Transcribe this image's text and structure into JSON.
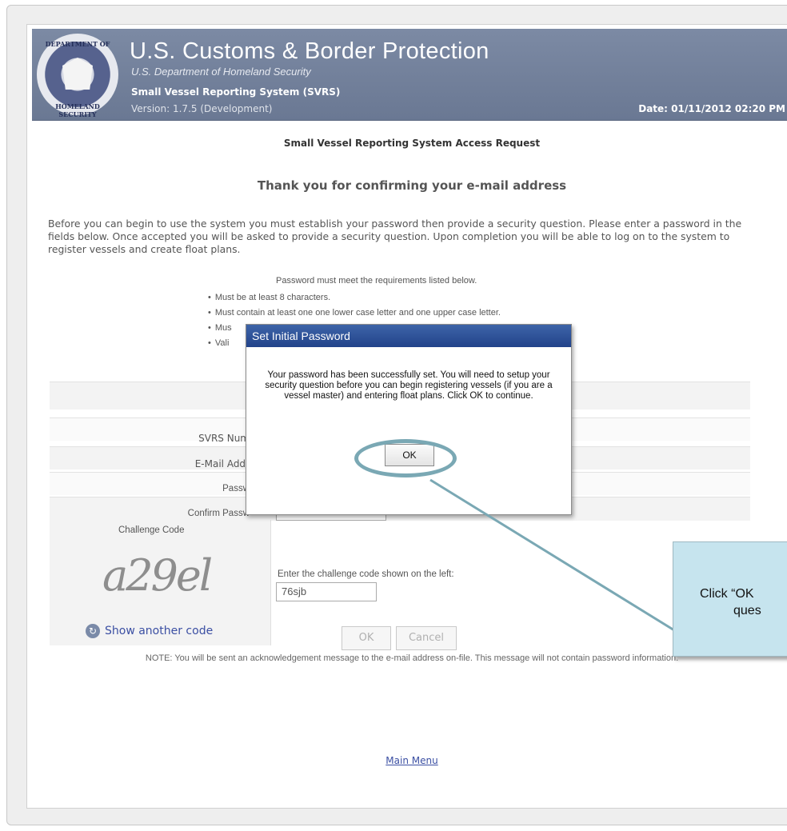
{
  "header": {
    "seal_top": "DEPARTMENT OF",
    "seal_bottom": "HOMELAND SECURITY",
    "agency_title": "U.S. Customs & Border Protection",
    "agency_subtitle": "U.S. Department of Homeland Security",
    "system_name": "Small Vessel Reporting System (SVRS)",
    "version": "Version: 1.7.5 (Development)",
    "date": "Date: 01/11/2012 02:20 PM"
  },
  "page": {
    "heading": "Small Vessel Reporting System Access Request",
    "confirm_heading": "Thank you for confirming your e-mail address",
    "intro": "Before you can begin to use the system you must establish your password then provide a security question. Please enter a password in the fields below. Once accepted you will be asked to provide a security question. Upon completion you will be able to log on to the system to register vessels and create float plans.",
    "requirements_title": "Password must meet the requirements listed below.",
    "requirements": [
      "Must be at least 8 characters.",
      "Must contain at least one one lower case letter and one upper case letter.",
      "Mus",
      "Vali"
    ]
  },
  "form": {
    "svrs_number_label": "SVRS Num",
    "email_label": "E-Mail Addr",
    "password_label": "Passw",
    "confirm_password_label": "Confirm Passw",
    "challenge_code_label": "Challenge Code",
    "captcha_text": "a29el",
    "show_another_code": "Show another code",
    "challenge_prompt": "Enter the challenge code shown on the left:",
    "challenge_value": "76sjb",
    "ok_button": "OK",
    "cancel_button": "Cancel"
  },
  "footer": {
    "note": "NOTE: You will be sent an acknowledgement message to the e-mail address on-file. This message will not contain password information.",
    "main_menu": "Main Menu"
  },
  "dialog": {
    "title": "Set Initial Password",
    "message": "Your password has been successfully set. You will need to setup your security question before you can begin registering vessels (if you are a vessel master) and entering float plans. Click OK to continue.",
    "ok_button": "OK"
  },
  "callout": {
    "line1": "Click “OK",
    "line2": "ques"
  },
  "colors": {
    "header_bg": "#6f7d97",
    "dialog_titlebar": "#2e4f95",
    "callout_bg": "#c6e4ee",
    "highlight_ring": "#7aa8b4",
    "link": "#3b4fa3"
  }
}
